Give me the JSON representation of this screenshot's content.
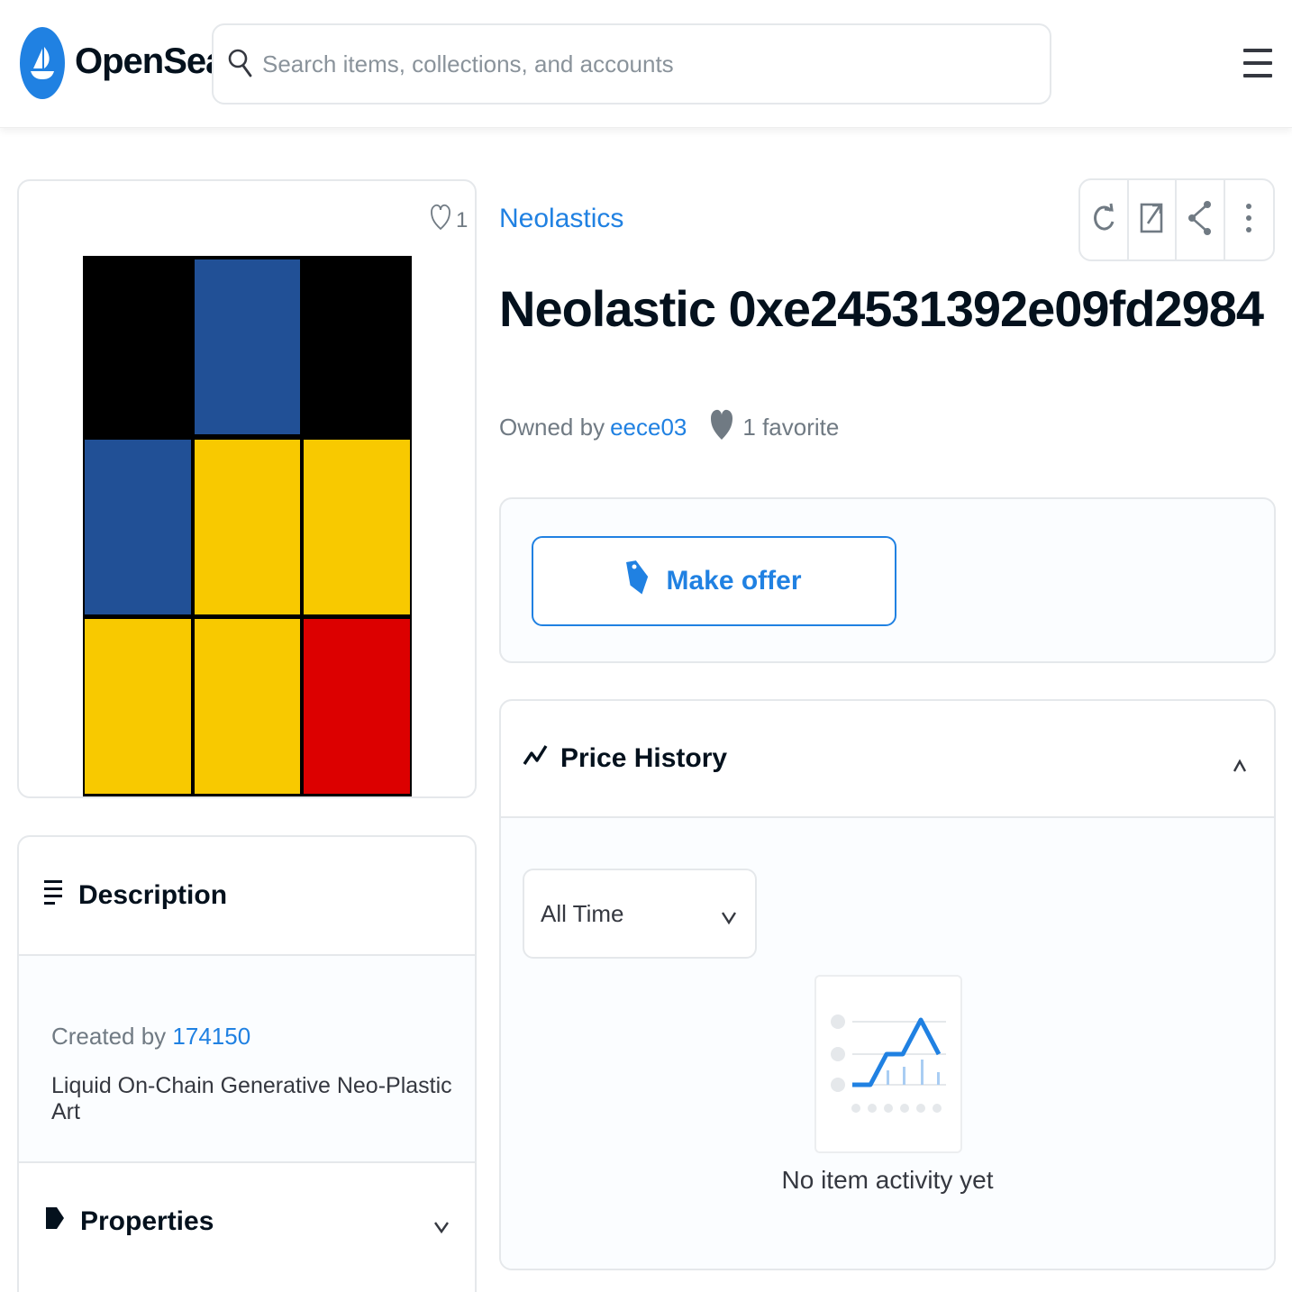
{
  "header": {
    "brand": "OpenSea",
    "search_placeholder": "Search items, collections, and accounts"
  },
  "media": {
    "favorite_count": "1",
    "artwork_colors": {
      "black": "#000000",
      "blue": "#215096",
      "yellow": "#f8c900",
      "red": "#dc0000"
    }
  },
  "description": {
    "heading": "Description",
    "created_by_label": "Created by",
    "creator": "174150",
    "text": "Liquid On-Chain Generative Neo-Plastic Art"
  },
  "properties": {
    "heading": "Properties"
  },
  "item": {
    "collection": "Neolastics",
    "title": "Neolastic 0xe24531392e09fd2984",
    "owned_by_label": "Owned by",
    "owner": "eece03",
    "favorites": "1 favorite"
  },
  "offer": {
    "button_label": "Make offer"
  },
  "price_history": {
    "heading": "Price History",
    "time_filter": "All Time",
    "empty_message": "No item activity yet"
  },
  "colors": {
    "accent": "#2081e2",
    "text_dark": "#04111d",
    "text_muted": "#707a83",
    "border": "#e5e8eb"
  }
}
